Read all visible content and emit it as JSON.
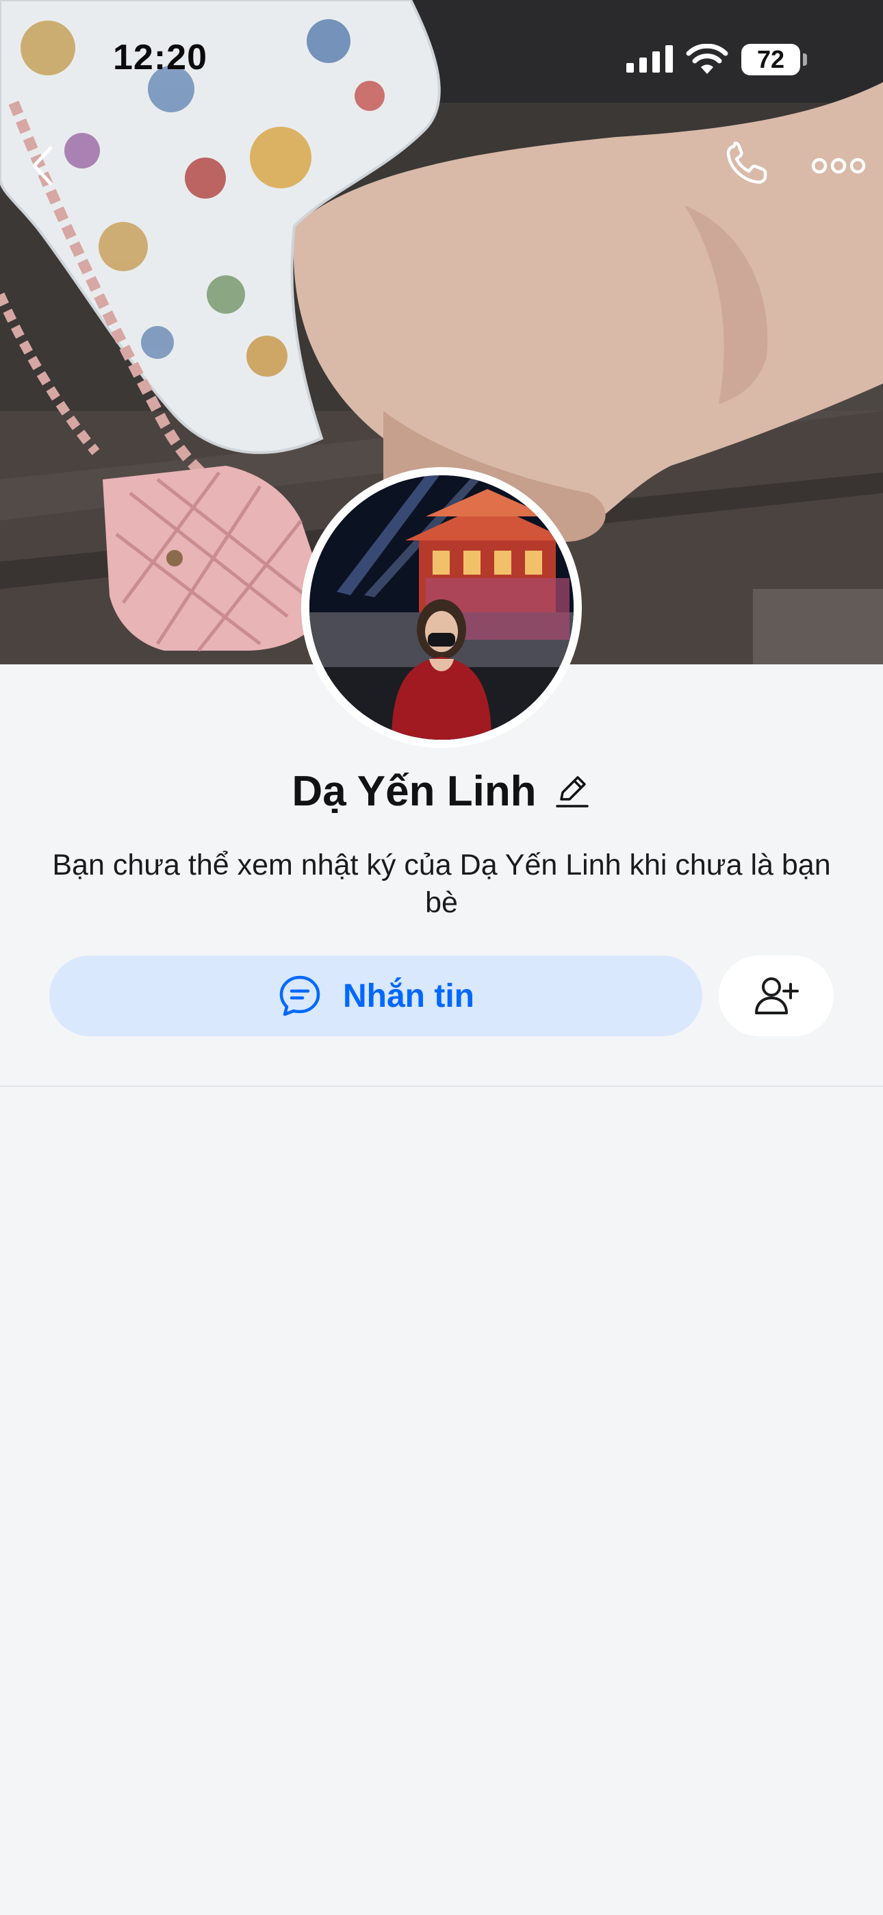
{
  "status_bar": {
    "time": "12:20",
    "battery": "72",
    "signal_icon": "cellular-signal-icon",
    "wifi_icon": "wifi-icon"
  },
  "nav": {
    "back_icon": "chevron-left-icon",
    "call_icon": "phone-icon",
    "more_icon": "more-horizontal-icon"
  },
  "profile": {
    "name": "Dạ Yến Linh",
    "edit_icon": "pencil-icon",
    "privacy_notice": "Bạn chưa thể xem nhật ký của Dạ Yến Linh khi chưa là bạn bè"
  },
  "actions": {
    "message_label": "Nhắn tin",
    "message_icon": "chat-bubble-icon",
    "add_friend_icon": "add-user-icon"
  },
  "colors": {
    "accent": "#0068ff",
    "message_button_bg": "#d9e8fd",
    "page_bg": "#f4f5f7"
  }
}
